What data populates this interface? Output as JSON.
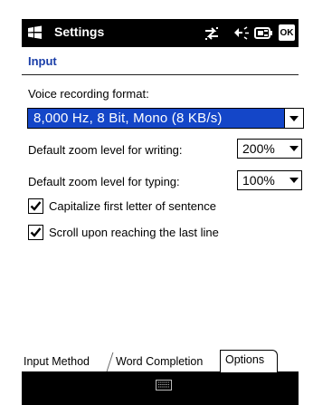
{
  "titlebar": {
    "title": "Settings",
    "ok_label": "OK",
    "icons": [
      "windows-start-icon",
      "connectivity-icon",
      "volume-icon",
      "battery-icon"
    ]
  },
  "page": {
    "title": "Input"
  },
  "voice": {
    "label": "Voice recording format:",
    "value": "8,000 Hz, 8 Bit, Mono (8 KB/s)"
  },
  "zoom_writing": {
    "label": "Default zoom level for writing:",
    "value": "200%"
  },
  "zoom_typing": {
    "label": "Default zoom level for typing:",
    "value": "100%"
  },
  "checks": [
    {
      "label": "Capitalize first letter of sentence",
      "checked": true
    },
    {
      "label": "Scroll upon reaching the last line",
      "checked": true
    }
  ],
  "tabs": [
    {
      "label": "Input Method",
      "active": false
    },
    {
      "label": "Word Completion",
      "active": false
    },
    {
      "label": "Options",
      "active": true
    }
  ],
  "bottombar": {
    "icon": "keyboard-icon"
  },
  "colors": {
    "selection": "#1446c8",
    "title_text": "#1a3ea8",
    "bar": "#000000"
  }
}
